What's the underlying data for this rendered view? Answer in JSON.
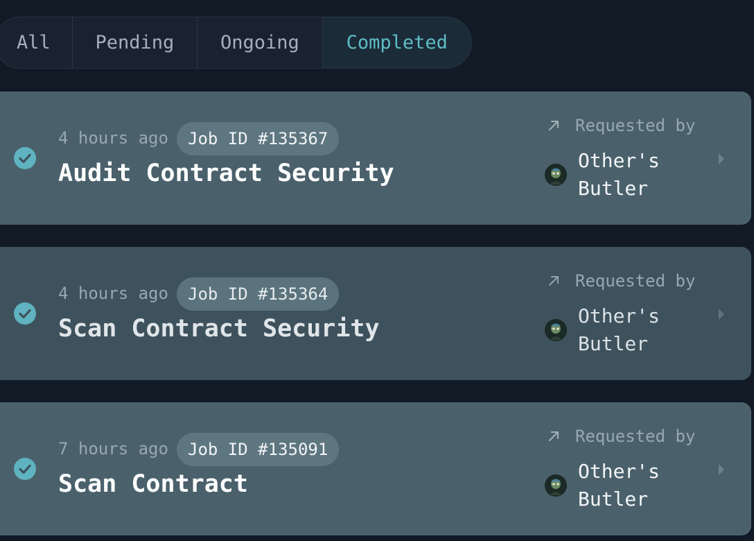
{
  "tabs": [
    {
      "label": "All",
      "active": false
    },
    {
      "label": "Pending",
      "active": false
    },
    {
      "label": "Ongoing",
      "active": false
    },
    {
      "label": "Completed",
      "active": true
    }
  ],
  "jobs": [
    {
      "status": "completed",
      "time": "4 hours ago",
      "job_id": "Job ID #135367",
      "title": "Audit Contract Security",
      "requested_label": "Requested by",
      "requester_line1": "Other's",
      "requester_line2": "Butler"
    },
    {
      "status": "completed",
      "time": "4 hours ago",
      "job_id": "Job ID #135364",
      "title": "Scan Contract Security",
      "requested_label": "Requested by",
      "requester_line1": "Other's",
      "requester_line2": "Butler"
    },
    {
      "status": "completed",
      "time": "7 hours ago",
      "job_id": "Job ID #135091",
      "title": "Scan Contract",
      "requested_label": "Requested by",
      "requester_line1": "Other's",
      "requester_line2": "Butler"
    }
  ],
  "colors": {
    "background": "#121a26",
    "accent": "#5fbdc6",
    "card_light": "#4a616c",
    "card_dark": "#3e525d"
  },
  "icons": {
    "status": "check-circle-icon",
    "requested": "arrow-up-right-icon",
    "open": "chevron-right-icon"
  }
}
